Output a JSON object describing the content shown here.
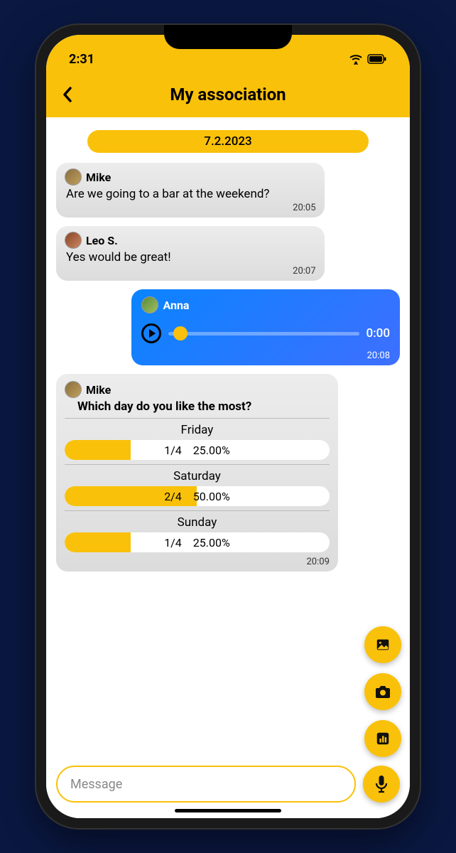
{
  "status": {
    "time": "2:31"
  },
  "header": {
    "title": "My association"
  },
  "date_label": "7.2.2023",
  "messages": {
    "m1": {
      "sender": "Mike",
      "text": "Are we going to a bar at the weekend?",
      "time": "20:05"
    },
    "m2": {
      "sender": "Leo S.",
      "text": "Yes would be great!",
      "time": "20:07"
    },
    "voice": {
      "sender": "Anna",
      "duration": "0:00",
      "time": "20:08"
    },
    "poll": {
      "sender": "Mike",
      "question": "Which day do you like the most?",
      "options": [
        {
          "label": "Friday",
          "count": "1/4",
          "pct": "25.00%",
          "fill": 25
        },
        {
          "label": "Saturday",
          "count": "2/4",
          "pct": "50.00%",
          "fill": 50
        },
        {
          "label": "Sunday",
          "count": "1/4",
          "pct": "25.00%",
          "fill": 25
        }
      ],
      "time": "20:09"
    }
  },
  "input": {
    "placeholder": "Message"
  }
}
